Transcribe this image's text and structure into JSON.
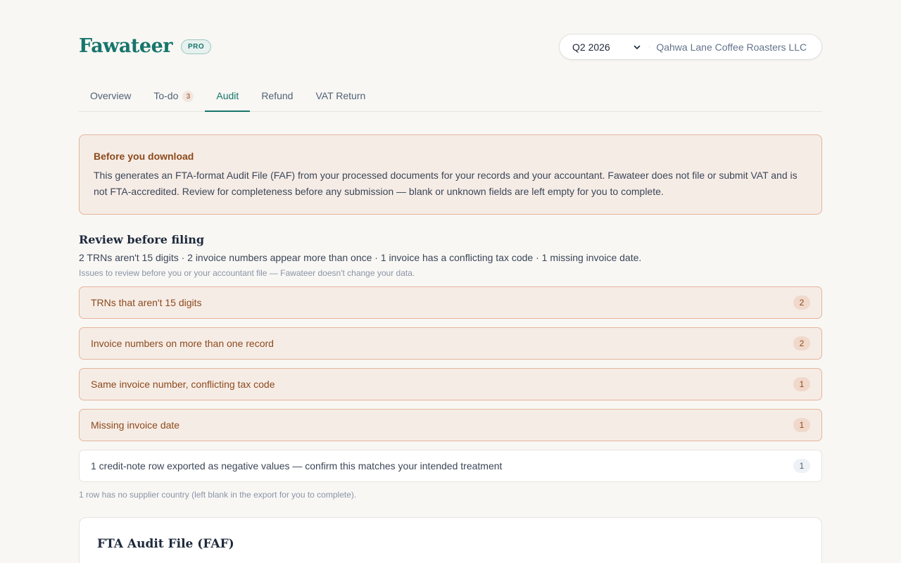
{
  "app": {
    "name": "Fawateer",
    "plan_badge": "PRO"
  },
  "header": {
    "period": "Q2 2026",
    "separator": "·",
    "company": "Qahwa Lane Coffee Roasters LLC"
  },
  "tabs": [
    {
      "label": "Overview"
    },
    {
      "label": "To-do",
      "count": "3"
    },
    {
      "label": "Audit",
      "active": true
    },
    {
      "label": "Refund"
    },
    {
      "label": "VAT Return"
    }
  ],
  "notice": {
    "title": "Before you download",
    "body": "This generates an FTA-format Audit File (FAF) from your processed documents for your records and your accountant. Fawateer does not file or submit VAT and is not FTA-accredited. Review for completeness before any submission — blank or unknown fields are left empty for you to complete."
  },
  "review": {
    "title": "Review before filing",
    "summary": "2 TRNs aren't 15 digits · 2 invoice numbers appear more than once · 1 invoice has a conflicting tax code · 1 missing invoice date.",
    "hint": "Issues to review before you or your accountant file — Fawateer doesn't change your data.",
    "issues": [
      {
        "label": "TRNs that aren't 15 digits",
        "count": "2"
      },
      {
        "label": "Invoice numbers on more than one record",
        "count": "2"
      },
      {
        "label": "Same invoice number, conflicting tax code",
        "count": "1"
      },
      {
        "label": "Missing invoice date",
        "count": "1"
      },
      {
        "label": "1 credit-note row exported as negative values — confirm this matches your intended treatment",
        "count": "1"
      }
    ],
    "footnote": "1 row has no supplier country (left blank in the export for you to complete)."
  },
  "faf": {
    "title": "FTA Audit File (FAF)"
  },
  "colors": {
    "brand": "#17756b",
    "warning_text": "#8c4a1c",
    "warning_bg": "#f6ece6",
    "warning_border": "#e5b59a",
    "page_bg": "#f8f7f4"
  }
}
